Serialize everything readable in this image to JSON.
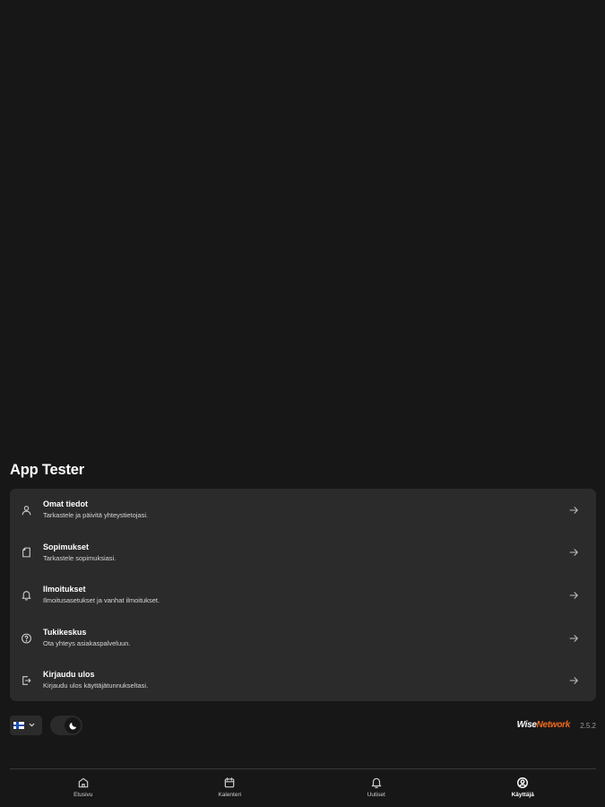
{
  "profile": {
    "name": "App Tester"
  },
  "menu": {
    "items": [
      {
        "title": "Omat tiedot",
        "subtitle": "Tarkastele ja päivitä yhteystietojasi.",
        "icon": "user-icon"
      },
      {
        "title": "Sopimukset",
        "subtitle": "Tarkastele sopimuksiasi.",
        "icon": "document-icon"
      },
      {
        "title": "Ilmoitukset",
        "subtitle": "Ilmoitusasetukset ja vanhat ilmoitukset.",
        "icon": "bell-icon"
      },
      {
        "title": "Tukikeskus",
        "subtitle": "Ota yhteys asiakaspalveluun.",
        "icon": "help-icon"
      },
      {
        "title": "Kirjaudu ulos",
        "subtitle": "Kirjaudu ulos käyttäjätunnukseltasi.",
        "icon": "logout-icon"
      }
    ]
  },
  "controls": {
    "language": "Finnish",
    "theme": "dark"
  },
  "brand": {
    "part1": "Wise",
    "part2": "Network",
    "accent_color": "#f26a1b"
  },
  "version": "2.5.2",
  "nav": {
    "items": [
      {
        "label": "Etusivu",
        "icon": "home-icon",
        "active": false
      },
      {
        "label": "Kalenteri",
        "icon": "calendar-icon",
        "active": false
      },
      {
        "label": "Uutiset",
        "icon": "bell-icon",
        "active": false
      },
      {
        "label": "Käyttäjä",
        "icon": "user-circle-icon",
        "active": true
      }
    ]
  }
}
